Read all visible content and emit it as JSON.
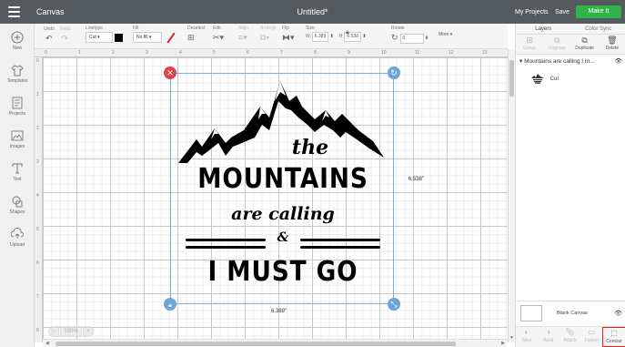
{
  "topbar": {
    "app_name": "Canvas",
    "doc_title": "Untitled*",
    "my_projects": "My Projects",
    "save": "Save",
    "make_it": "Make It"
  },
  "toolbar": {
    "undo": "Undo",
    "redo": "Redo",
    "linetype_label": "Linetype",
    "linetype_value": "Cut",
    "fill_label": "Fill",
    "fill_value": "No fill",
    "deselect": "Deselect",
    "edit": "Edit",
    "align": "Align",
    "arrange": "Arrange",
    "flip": "Flip",
    "size_label": "Size",
    "w_label": "W",
    "w_value": "6.389",
    "h_label": "H",
    "h_value": "6.538",
    "rotate_label": "Rotate",
    "rotate_value": "0",
    "more": "More ▾"
  },
  "ruler_top": [
    "0",
    "1",
    "2",
    "3",
    "4",
    "5",
    "6",
    "7",
    "8",
    "9",
    "10",
    "11",
    "12",
    "13"
  ],
  "ruler_left": [
    "0",
    "1",
    "2",
    "3",
    "4",
    "5",
    "6",
    "7",
    "8"
  ],
  "sidebar": {
    "items": [
      {
        "label": "New",
        "icon": "plus-circle-icon"
      },
      {
        "label": "Templates",
        "icon": "shirt-icon"
      },
      {
        "label": "Projects",
        "icon": "projects-icon"
      },
      {
        "label": "Images",
        "icon": "images-icon"
      },
      {
        "label": "Text",
        "icon": "text-icon"
      },
      {
        "label": "Shapes",
        "icon": "shapes-icon"
      },
      {
        "label": "Upload",
        "icon": "upload-icon"
      }
    ]
  },
  "design": {
    "line1": "the",
    "line2": "MOUNTAINS",
    "line3": "are calling",
    "line4": "&",
    "line5": "I MUST GO"
  },
  "dims": {
    "height": "6.538\"",
    "width": "6.389\""
  },
  "zoom": {
    "out": "−",
    "level": "100%",
    "in": "+"
  },
  "rpanel": {
    "tab_layers": "Layers",
    "tab_color_sync": "Color Sync",
    "actions": [
      "Group",
      "Ungroup",
      "Duplicate",
      "Delete"
    ],
    "layer_group": "Mountains are calling I m...",
    "layer_item": "Cut",
    "blank_canvas": "Blank Canvas",
    "bottom_actions": [
      "Slice",
      "Weld",
      "Attach",
      "Flatten",
      "Contour"
    ]
  },
  "colors": {
    "topbar": "#555a5f",
    "make_it": "#2fb34a",
    "delete_handle": "#e0424f",
    "handle": "#6ea4d6",
    "highlight": "#e02020"
  }
}
